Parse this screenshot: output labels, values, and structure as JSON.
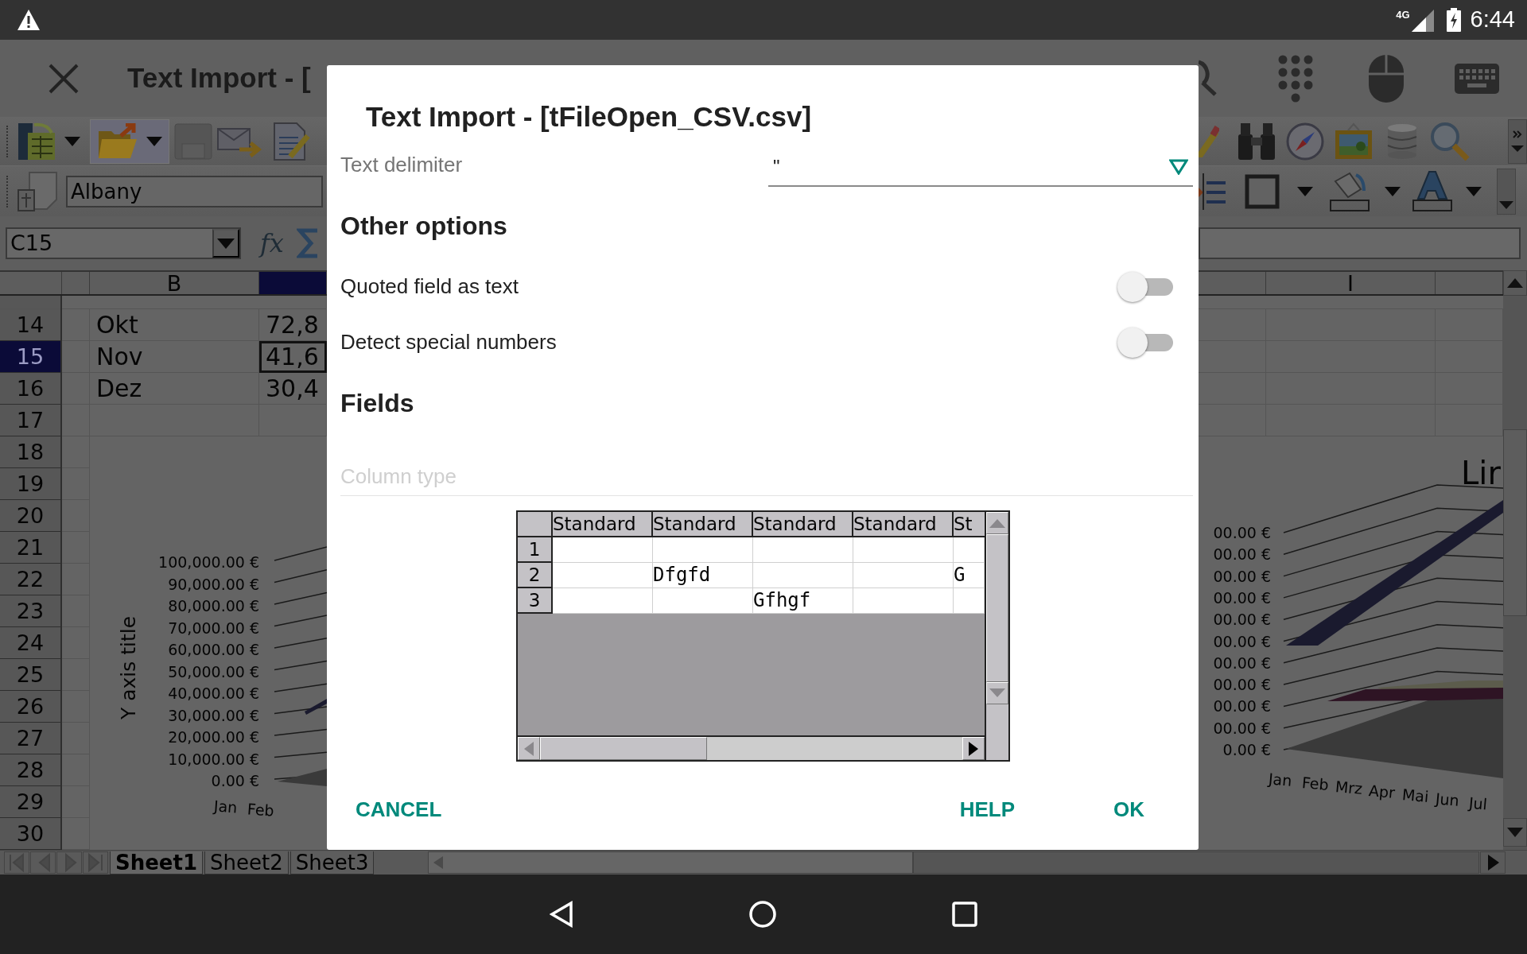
{
  "status_bar": {
    "network": "4G",
    "time": "6:44"
  },
  "app_bar": {
    "title": "Text Import - ["
  },
  "font_name": "Albany",
  "name_box": "C15",
  "function_wizard": "fx",
  "sheet": {
    "columns_left": [
      {
        "label": "B",
        "selected": false
      },
      {
        "selected": true
      }
    ],
    "columns_right": [
      {
        "label": "I",
        "selected": false
      }
    ],
    "rows": [
      {
        "number": "14",
        "column_b": "Okt",
        "column_c": "72,8",
        "selected": false
      },
      {
        "number": "15",
        "column_b": "Nov",
        "column_c": "41,6",
        "selected": true
      },
      {
        "number": "16",
        "column_b": "Dez",
        "column_c": "30,4",
        "selected": false
      },
      {
        "number": "17",
        "selected": false
      }
    ],
    "chart_rows": [
      "18",
      "19",
      "20",
      "21",
      "22",
      "23",
      "24",
      "25",
      "26",
      "27",
      "28",
      "29",
      "30"
    ]
  },
  "chart": {
    "y_axis_title": "Y axis title",
    "left_ticks": [
      "100,000.00 €",
      "90,000.00 €",
      "80,000.00 €",
      "70,000.00 €",
      "60,000.00 €",
      "50,000.00 €",
      "40,000.00 €",
      "30,000.00 €",
      "20,000.00 €",
      "10,000.00 €",
      "0.00 €"
    ],
    "left_categories": [
      "Jan",
      "Feb"
    ],
    "right_title": "Lir",
    "right_ticks": [
      "00.00 €",
      "00.00 €",
      "00.00 €",
      "00.00 €",
      "00.00 €",
      "00.00 €",
      "00.00 €",
      "00.00 €",
      "00.00 €",
      "00.00 €",
      "0.00 €"
    ],
    "right_categories": [
      "Jan",
      "Feb",
      "Mrz",
      "Apr",
      "Mai",
      "Jun",
      "Jul"
    ]
  },
  "sheet_tabs": [
    {
      "label": "Sheet1",
      "selected": true
    },
    {
      "label": "Sheet2",
      "selected": false
    },
    {
      "label": "Sheet3",
      "selected": false
    }
  ],
  "dialog": {
    "title": "Text Import - [tFileOpen_CSV.csv]",
    "text_delimiter": {
      "label": "Text delimiter",
      "value": "\""
    },
    "other_options_heading": "Other options",
    "toggles": [
      {
        "label": "Quoted field as text",
        "on": false
      },
      {
        "label": "Detect special numbers",
        "on": false
      }
    ],
    "fields_heading": "Fields",
    "column_type": {
      "placeholder": "Column type",
      "disabled": true
    },
    "preview": {
      "columns": [
        "Standard",
        "Standard",
        "Standard",
        "Standard",
        "St"
      ],
      "rows": [
        {
          "number": "1"
        },
        {
          "number": "2",
          "column_2": "Dfgfd",
          "column_5": "G"
        },
        {
          "number": "3",
          "column_3": "Gfhgf"
        }
      ]
    },
    "buttons": [
      "CANCEL",
      "HELP",
      "OK"
    ]
  }
}
